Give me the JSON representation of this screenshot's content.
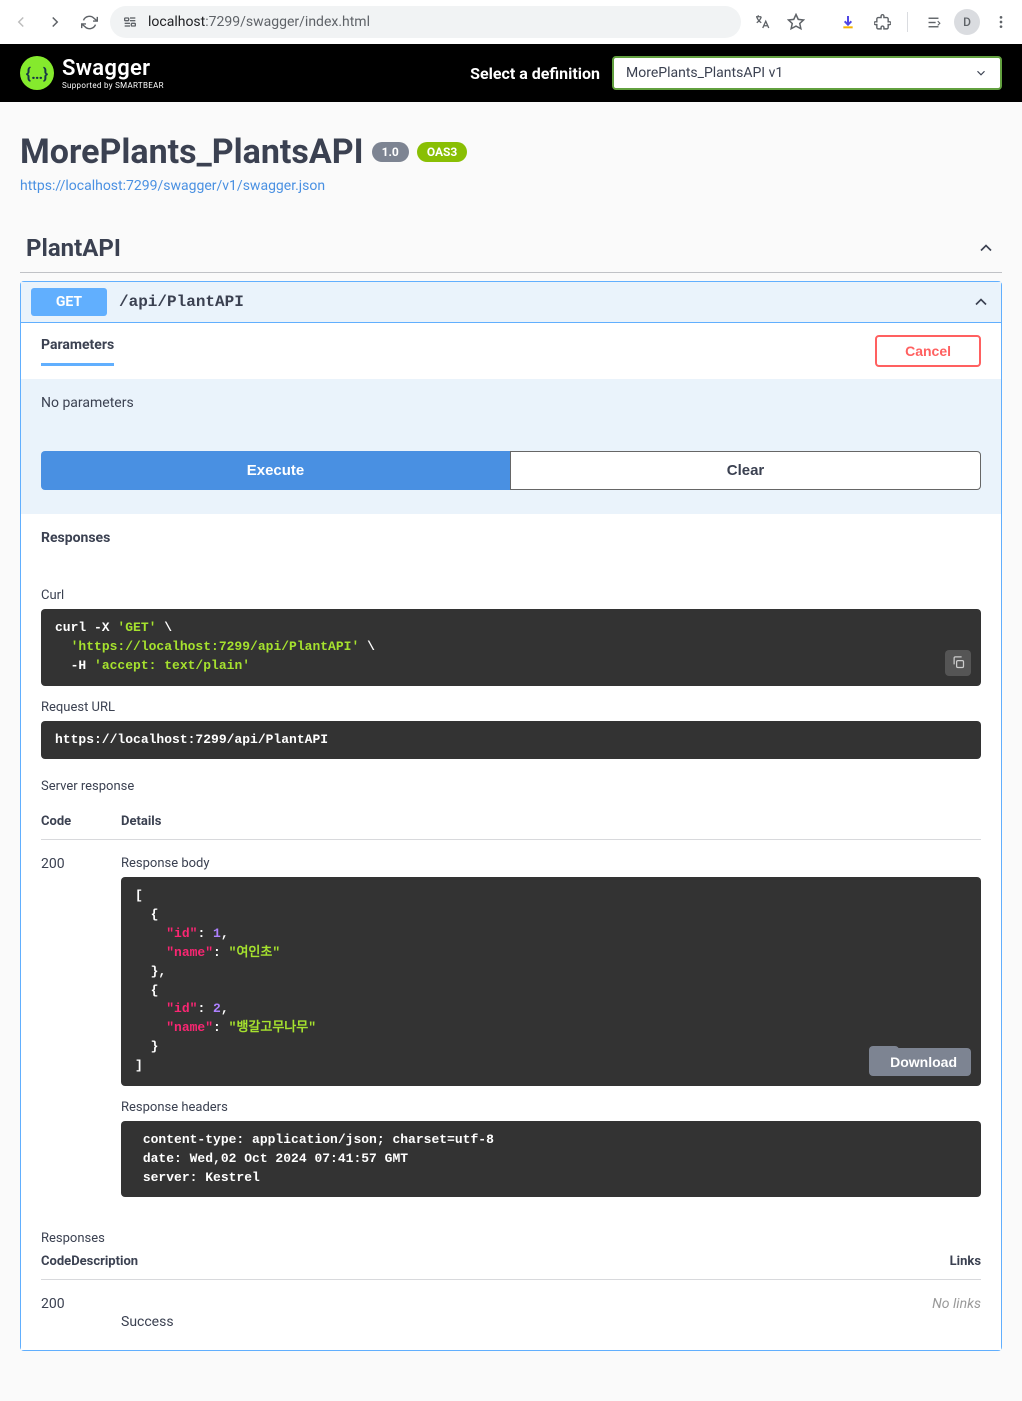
{
  "browser": {
    "url_host": "localhost",
    "url_path": ":7299/swagger/index.html",
    "avatar_letter": "D"
  },
  "header": {
    "brand": "Swagger",
    "byline": "Supported by SMARTBEAR",
    "select_label": "Select a definition",
    "select_value": "MorePlants_PlantsAPI v1"
  },
  "title": {
    "name": "MorePlants_PlantsAPI",
    "version": "1.0",
    "oas": "OAS3",
    "link": "https://localhost:7299/swagger/v1/swagger.json"
  },
  "tag": {
    "name": "PlantAPI"
  },
  "operation": {
    "method": "GET",
    "path": "/api/PlantAPI",
    "parameters_title": "Parameters",
    "cancel": "Cancel",
    "no_params": "No parameters",
    "execute": "Execute",
    "clear": "Clear",
    "responses_title": "Responses"
  },
  "result": {
    "curl_label": "Curl",
    "curl_line1a": "curl -X ",
    "curl_line1b": "'GET'",
    "curl_line2": "'https://localhost:7299/api/PlantAPI'",
    "curl_line3a": "-H ",
    "curl_line3b": "'accept: text/plain'",
    "req_url_label": "Request URL",
    "req_url": "https://localhost:7299/api/PlantAPI",
    "server_response_label": "Server response",
    "code_head": "Code",
    "details_head": "Details",
    "status_code": "200",
    "response_body_label": "Response body",
    "body_items": [
      {
        "id": 1,
        "name": "여인초"
      },
      {
        "id": 2,
        "name": "뱅갈고무나무"
      }
    ],
    "download": "Download",
    "response_headers_label": "Response headers",
    "headers_text": " content-type: application/json; charset=utf-8 \n date: Wed,02 Oct 2024 07:41:57 GMT \n server: Kestrel "
  },
  "doc_responses": {
    "title": "Responses",
    "code_head": "Code",
    "desc_head": "Description",
    "links_head": "Links",
    "row_code": "200",
    "row_desc": "Success",
    "row_links": "No links"
  }
}
